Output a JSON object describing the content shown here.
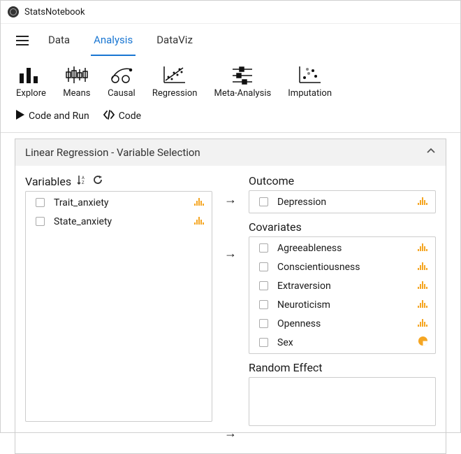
{
  "app": {
    "title": "StatsNotebook"
  },
  "tabs": {
    "data": "Data",
    "analysis": "Analysis",
    "dataviz": "DataViz",
    "active": "analysis"
  },
  "toolbar": {
    "explore": "Explore",
    "means": "Means",
    "causal": "Causal",
    "regression": "Regression",
    "meta": "Meta-Analysis",
    "imputation": "Imputation"
  },
  "runbar": {
    "codeAndRun": "Code and Run",
    "code": "Code"
  },
  "panel": {
    "title": "Linear Regression - Variable Selection"
  },
  "sections": {
    "variables": "Variables",
    "outcome": "Outcome",
    "covariates": "Covariates",
    "randomEffect": "Random Effect"
  },
  "variables": [
    {
      "label": "Trait_anxiety",
      "type": "numeric"
    },
    {
      "label": "State_anxiety",
      "type": "numeric"
    }
  ],
  "outcome": [
    {
      "label": "Depression",
      "type": "numeric"
    }
  ],
  "covariates": [
    {
      "label": "Agreeableness",
      "type": "numeric"
    },
    {
      "label": "Conscientiousness",
      "type": "numeric"
    },
    {
      "label": "Extraversion",
      "type": "numeric"
    },
    {
      "label": "Neuroticism",
      "type": "numeric"
    },
    {
      "label": "Openness",
      "type": "numeric"
    },
    {
      "label": "Sex",
      "type": "categorical"
    }
  ],
  "colors": {
    "accent": "#1976d2",
    "distIcon": "#f5a623",
    "pieIcon": "#f5a623"
  }
}
